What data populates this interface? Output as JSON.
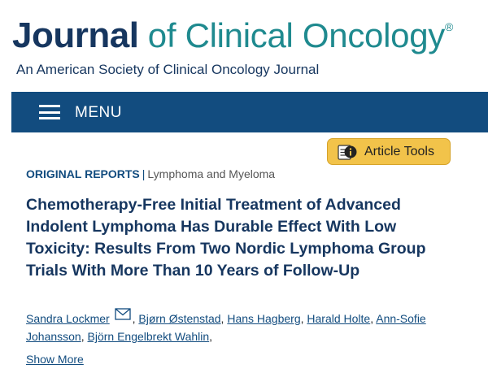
{
  "masthead": {
    "journal_name_bold": "Journal",
    "journal_name_rest": " of Clinical Oncology",
    "registered_mark": "®",
    "subtitle": "An American Society of Clinical Oncology Journal"
  },
  "nav": {
    "menu_label": "MENU",
    "menu_icon": "hamburger-icon"
  },
  "article_tools": {
    "label": "Article Tools",
    "icon": "article-info-icon",
    "bg_color": "#f2c34a"
  },
  "category": {
    "primary": "ORIGINAL REPORTS",
    "separator": "|",
    "secondary": "Lymphoma and Myeloma"
  },
  "article": {
    "title": "Chemotherapy-Free Initial Treatment of Advanced Indolent Lymphoma Has Durable Effect With Low Toxicity: Results From Two Nordic Lymphoma Group Trials With More Than 10 Years of Follow-Up"
  },
  "authors": {
    "list": [
      "Sandra Lockmer",
      "Bjørn Østenstad",
      "Hans Hagberg",
      "Harald Holte",
      "Ann-Sofie Johansson",
      "Björn Engelbrekt Wahlin"
    ],
    "separator": ", ",
    "trailing": ",",
    "mail_icon": "envelope-icon",
    "show_more_label": "Show More"
  },
  "colors": {
    "brand_navy": "#16365f",
    "brand_teal": "#1f8a8f",
    "menu_bar": "#124c7f",
    "link": "#124c7f"
  }
}
